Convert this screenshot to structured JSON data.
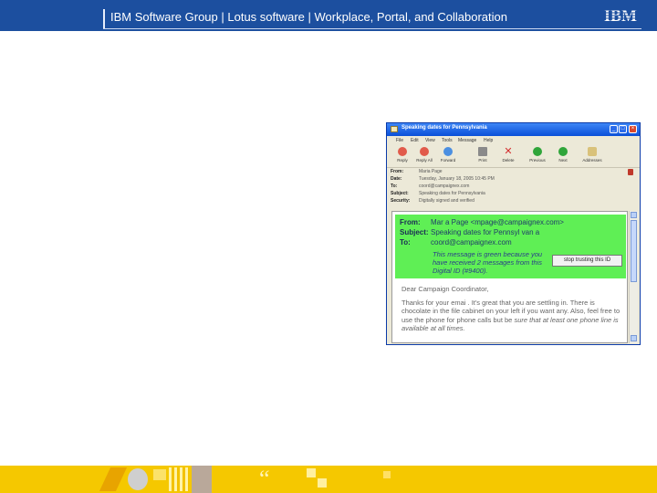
{
  "header": {
    "title": "IBM Software Group  |  Lotus software  | Workplace, Portal, and Collaboration",
    "logo_text": "IBM",
    "band_color": "#1c4f9f"
  },
  "window": {
    "title": "Speaking dates for Pennsylvania",
    "menu": [
      "File",
      "Edit",
      "View",
      "Tools",
      "Message",
      "Help"
    ],
    "toolbar": [
      {
        "label": "Reply",
        "icon": "reply-icon",
        "color": "#e15b4b"
      },
      {
        "label": "Reply All",
        "icon": "reply-all-icon",
        "color": "#e15b4b"
      },
      {
        "label": "Forward",
        "icon": "forward-icon",
        "color": "#4b8fe1"
      },
      {
        "label": "Print",
        "icon": "print-icon",
        "color": "#8a8a8a"
      },
      {
        "label": "Delete",
        "icon": "delete-icon",
        "color": "#d32f2f"
      },
      {
        "label": "Previous",
        "icon": "previous-icon",
        "color": "#2fa53a"
      },
      {
        "label": "Next",
        "icon": "next-icon",
        "color": "#2fa53a"
      },
      {
        "label": "Addresses",
        "icon": "addresses-icon",
        "color": "#d9c27a"
      }
    ],
    "headers": [
      {
        "key": "From:",
        "value": "Maria Page"
      },
      {
        "key": "Date:",
        "value": "Tuesday, January 18, 2005 10:45 PM"
      },
      {
        "key": "To:",
        "value": "coord@campaignex.com"
      },
      {
        "key": "Subject:",
        "value": "Speaking dates for Pennsylvania"
      },
      {
        "key": "Security:",
        "value": "Digitally signed and verified"
      }
    ],
    "message": {
      "from_label": "From:",
      "from_value": "Mar a Page <mpage@campaignex.com>",
      "subject_label": "Subject:",
      "subject_value": "Speaking dates for Pennsyl van a",
      "to_label": "To:",
      "to_value": "coord@campaignex.com",
      "note": "This message is green because you have received 2 messages from this Digital ID (#9400).",
      "stop_button": "stop trusting this ID",
      "greeting": "Dear Campaign Coordinator,",
      "body_1": "Thanks for your emai . It's great that you are settling in. There is chocolate in the file cabinet on your left if you want any. Also, feel free to use the phone for phone calls but be ",
      "body_emphasis": "sure that at least one phone line is available at all times.",
      "highlight_color": "#5fef55"
    }
  },
  "footer": {
    "band_color": "#f5c800"
  }
}
